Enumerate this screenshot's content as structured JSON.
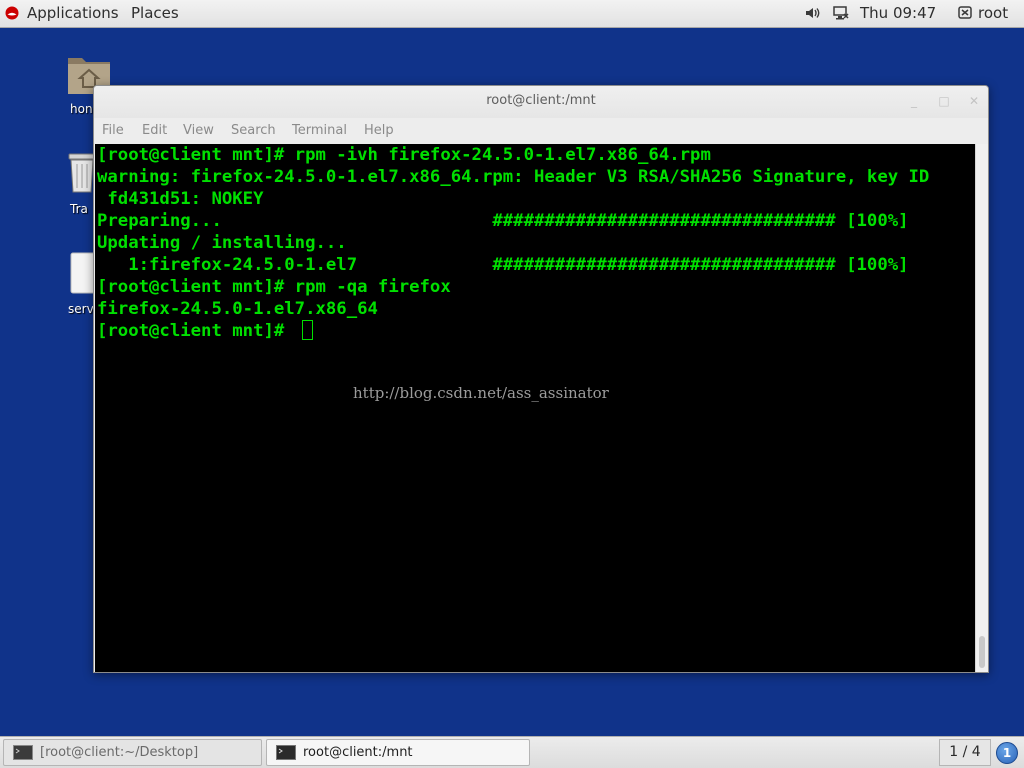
{
  "top_panel": {
    "applications_label": "Applications",
    "places_label": "Places",
    "clock": "Thu 09:47",
    "user": "root"
  },
  "desktop": {
    "icons": [
      {
        "label": "hon",
        "icon": "home-folder-icon"
      },
      {
        "label": "Tra",
        "icon": "trash-icon"
      },
      {
        "label": "serv",
        "icon": "file-icon"
      }
    ]
  },
  "window": {
    "title": "root@client:/mnt",
    "menu": [
      "File",
      "Edit",
      "View",
      "Search",
      "Terminal",
      "Help"
    ]
  },
  "terminal": {
    "lines": [
      "[root@client mnt]# rpm -ivh firefox-24.5.0-1.el7.x86_64.rpm",
      "warning: firefox-24.5.0-1.el7.x86_64.rpm: Header V3 RSA/SHA256 Signature, key ID",
      " fd431d51: NOKEY",
      "Preparing...                          ################################# [100%]",
      "Updating / installing...",
      "   1:firefox-24.5.0-1.el7             ################################# [100%]",
      "[root@client mnt]# rpm -qa firefox",
      "firefox-24.5.0-1.el7.x86_64",
      "[root@client mnt]# "
    ],
    "text_color": "#00e000",
    "background": "#000000",
    "watermark": "http://blog.csdn.net/ass_assinator"
  },
  "taskbar": {
    "tasks": [
      {
        "label": "[root@client:~/Desktop]",
        "active": false
      },
      {
        "label": "root@client:/mnt",
        "active": true
      }
    ],
    "workspace": "1 / 4",
    "notifications": "1"
  },
  "colors": {
    "desktop": "#10338a",
    "terminal_text": "#00e000"
  }
}
